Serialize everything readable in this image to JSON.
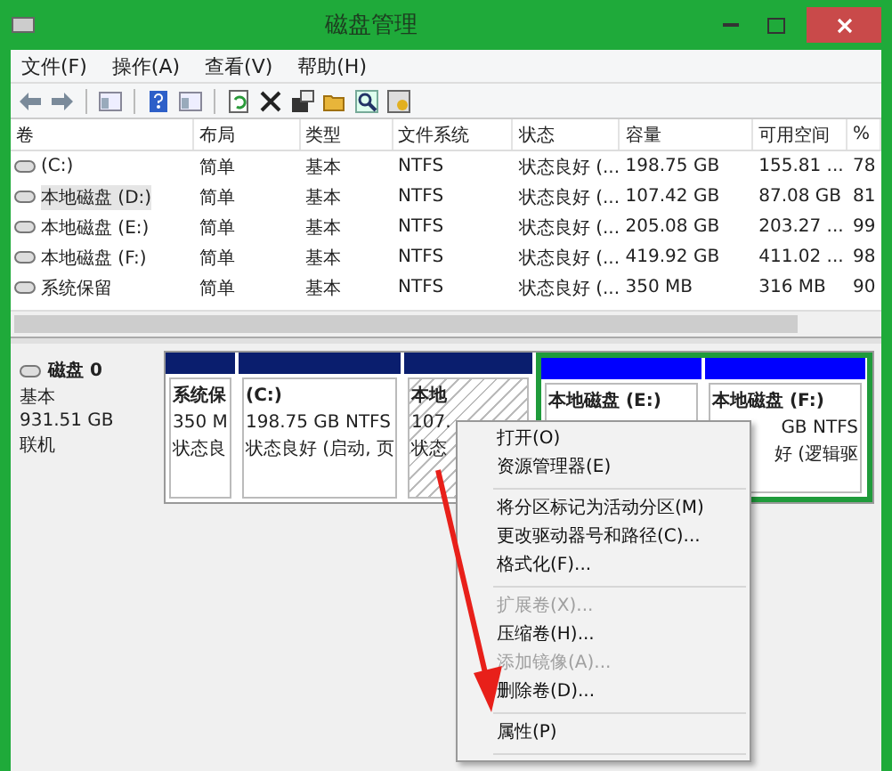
{
  "window": {
    "title": "磁盘管理"
  },
  "menu_bar": [
    "文件(F)",
    "操作(A)",
    "查看(V)",
    "帮助(H)"
  ],
  "volume_table": {
    "columns": [
      "卷",
      "布局",
      "类型",
      "文件系统",
      "状态",
      "容量",
      "可用空间",
      "%"
    ],
    "rows": [
      {
        "selected": false,
        "cells": [
          "(C:)",
          "简单",
          "基本",
          "NTFS",
          "状态良好 (...",
          "198.75 GB",
          "155.81 ...",
          "78"
        ]
      },
      {
        "selected": true,
        "cells": [
          "本地磁盘 (D:)",
          "简单",
          "基本",
          "NTFS",
          "状态良好 (...",
          "107.42 GB",
          "87.08 GB",
          "81"
        ]
      },
      {
        "selected": false,
        "cells": [
          "本地磁盘 (E:)",
          "简单",
          "基本",
          "NTFS",
          "状态良好 (...",
          "205.08 GB",
          "203.27 ...",
          "99"
        ]
      },
      {
        "selected": false,
        "cells": [
          "本地磁盘 (F:)",
          "简单",
          "基本",
          "NTFS",
          "状态良好 (...",
          "419.92 GB",
          "411.02 ...",
          "98"
        ]
      },
      {
        "selected": false,
        "cells": [
          "系统保留",
          "简单",
          "基本",
          "NTFS",
          "状态良好 (...",
          "350 MB",
          "316 MB",
          "90"
        ]
      }
    ]
  },
  "disk": {
    "name": "磁盘 0",
    "type": "基本",
    "size": "931.51 GB",
    "status": "联机",
    "partitions": [
      {
        "kind": "primary",
        "selected": false,
        "lines": [
          "系统保",
          "350 M",
          "状态良"
        ]
      },
      {
        "kind": "primary",
        "selected": false,
        "lines": [
          "(C:)",
          "198.75 GB NTFS",
          "状态良好 (启动, 页"
        ]
      },
      {
        "kind": "primary",
        "selected": true,
        "lines": [
          "本地",
          "107.",
          "状态"
        ]
      },
      {
        "kind": "logical",
        "selected": false,
        "lines": [
          "本地磁盘 (E:)"
        ]
      },
      {
        "kind": "logical",
        "selected": false,
        "lines": [
          "本地磁盘 (F:)",
          "GB NTFS",
          "好 (逻辑驱"
        ]
      }
    ]
  },
  "context_menu": [
    {
      "kind": "item",
      "label": "打开(O)",
      "disabled": false
    },
    {
      "kind": "item",
      "label": "资源管理器(E)",
      "disabled": false
    },
    {
      "kind": "separator"
    },
    {
      "kind": "item",
      "label": "将分区标记为活动分区(M)",
      "disabled": false
    },
    {
      "kind": "item",
      "label": "更改驱动器号和路径(C)...",
      "disabled": false
    },
    {
      "kind": "item",
      "label": "格式化(F)...",
      "disabled": false
    },
    {
      "kind": "separator"
    },
    {
      "kind": "item",
      "label": "扩展卷(X)...",
      "disabled": true
    },
    {
      "kind": "item",
      "label": "压缩卷(H)...",
      "disabled": false
    },
    {
      "kind": "item",
      "label": "添加镜像(A)...",
      "disabled": true
    },
    {
      "kind": "item",
      "label": "删除卷(D)...",
      "disabled": false
    },
    {
      "kind": "separator"
    },
    {
      "kind": "item",
      "label": "属性(P)",
      "disabled": false
    },
    {
      "kind": "separator"
    }
  ]
}
